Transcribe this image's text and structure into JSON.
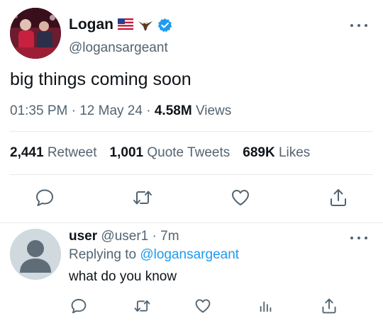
{
  "tweet": {
    "display_name": "Logan",
    "emojis": [
      "us-flag-icon",
      "eagle-icon"
    ],
    "verified": true,
    "handle": "@logansargeant",
    "text": "big things coming soon",
    "time": "01:35 PM",
    "separator": "·",
    "date": "12 May 24",
    "views_count": "4.58M",
    "views_label": "Views",
    "stats": {
      "retweets_count": "2,441",
      "retweets_label": "Retweet",
      "quotes_count": "1,001",
      "quotes_label": "Quote Tweets",
      "likes_count": "689K",
      "likes_label": "Likes"
    },
    "actions": [
      "reply-icon",
      "retweet-icon",
      "like-icon",
      "share-icon"
    ]
  },
  "reply": {
    "display_name": "user",
    "handle_time": "@user1 · 7m",
    "replying_prefix": "Replying to",
    "replying_to": "@logansargeant",
    "text": "what do you know",
    "actions": [
      "reply-icon",
      "retweet-icon",
      "like-icon",
      "analytics-icon",
      "share-icon"
    ]
  },
  "colors": {
    "text": "#0f1419",
    "secondary": "#536471",
    "accent": "#1d9bf0",
    "divider": "#e6e9ec"
  }
}
